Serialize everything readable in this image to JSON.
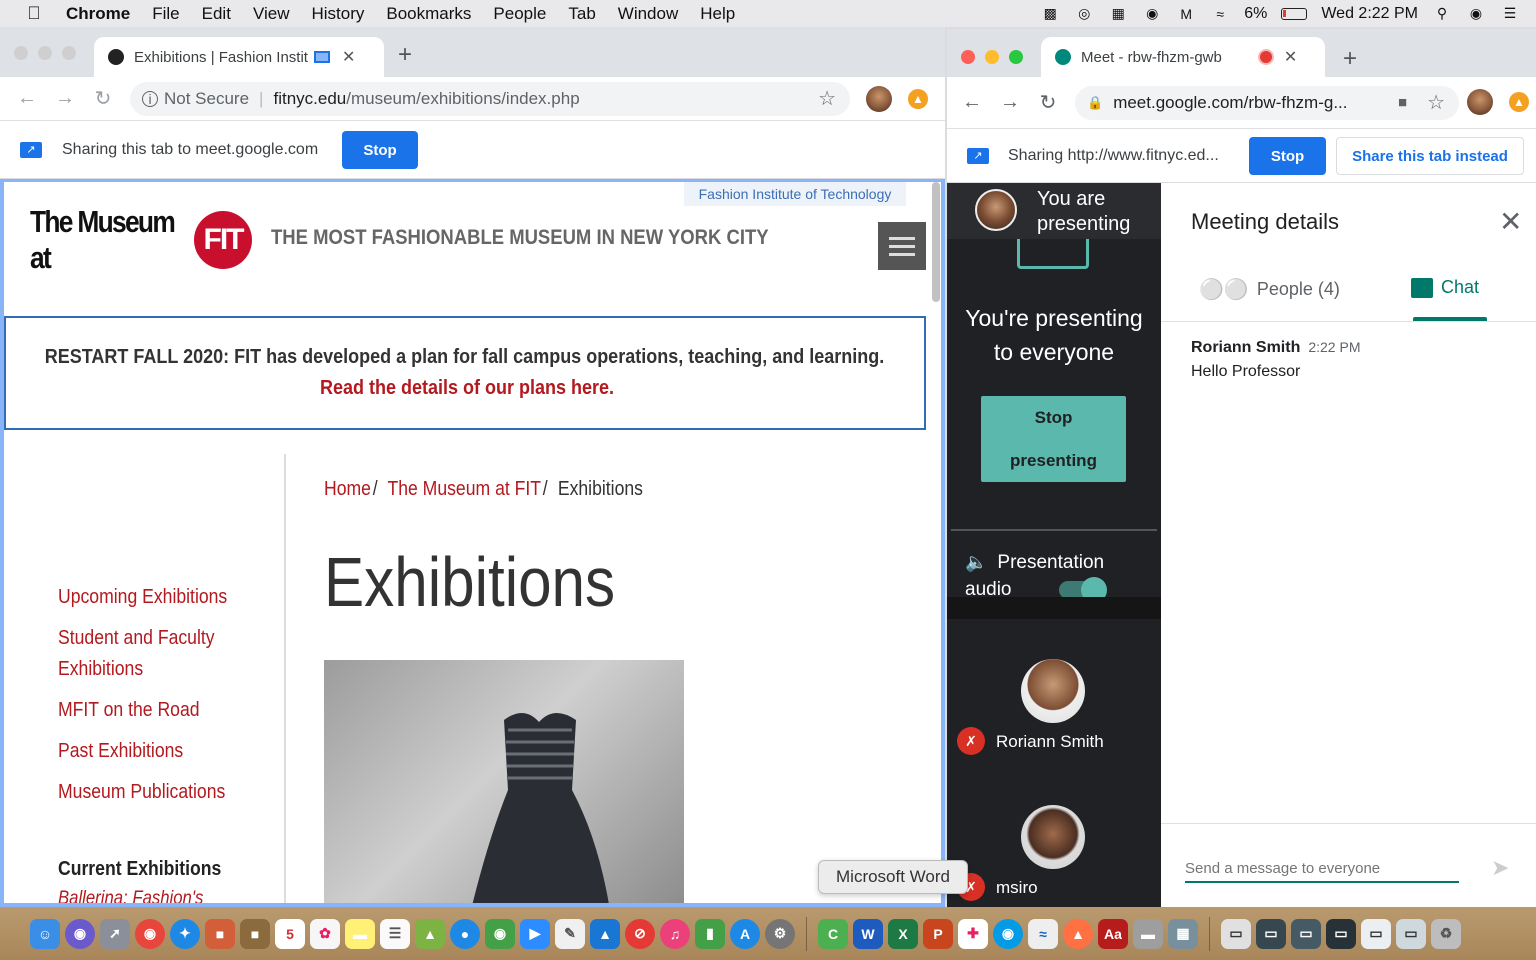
{
  "menubar": {
    "app": "Chrome",
    "items": [
      "File",
      "Edit",
      "View",
      "History",
      "Bookmarks",
      "People",
      "Tab",
      "Window",
      "Help"
    ],
    "battery": "6%",
    "clock": "Wed 2:22 PM"
  },
  "left_window": {
    "tab_title": "Exhibitions | Fashion Instit",
    "not_secure": "Not Secure",
    "url_domain": "fitnyc.edu",
    "url_path": "/museum/exhibitions/index.php",
    "share_text": "Sharing this tab to meet.google.com",
    "stop_label": "Stop"
  },
  "page": {
    "fit_tag": "Fashion Institute of Technology",
    "logo_text": "The Museum at",
    "logo_fit": "FIT",
    "tagline": "THE MOST FASHIONABLE MUSEUM IN NEW YORK CITY",
    "banner_text": "RESTART FALL 2020: FIT has developed a plan for fall campus operations, teaching, and learning.",
    "banner_link": "Read the details of our plans here.",
    "breadcrumb": [
      "Home",
      "The Museum at FIT",
      "Exhibitions"
    ],
    "heading": "Exhibitions",
    "sidenav": [
      "Upcoming Exhibitions",
      "Student and Faculty Exhibitions",
      "MFIT on the Road",
      "Past Exhibitions",
      "Museum Publications"
    ],
    "current_heading": "Current Exhibitions",
    "current_item": "Ballerina: Fashion's"
  },
  "right_window": {
    "tab_title": "Meet - rbw-fhzm-gwb",
    "url": "meet.google.com/rbw-fhzm-g...",
    "share_text": "Sharing http://www.fitnyc.ed...",
    "stop_label": "Stop",
    "share_instead": "Share this tab instead"
  },
  "meet": {
    "you_presenting": "You are presenting",
    "presenting_everyone": "You're presenting to everyone",
    "stop_line1": "Stop",
    "stop_line2": "presenting",
    "audio_label": "Presentation audio",
    "participants": [
      "Roriann Smith",
      "msiro"
    ]
  },
  "details": {
    "title": "Meeting details",
    "people_tab": "People (4)",
    "chat_tab": "Chat",
    "messages": [
      {
        "sender": "Roriann Smith",
        "time": "2:22 PM",
        "text": "Hello Professor"
      }
    ],
    "compose_placeholder": "Send a message to everyone"
  },
  "tooltip": "Microsoft Word",
  "colors": {
    "fit_red": "#c8102e",
    "link_red": "#b3191e",
    "meet_teal": "#5bb8ac",
    "google_blue": "#1a73e8"
  }
}
